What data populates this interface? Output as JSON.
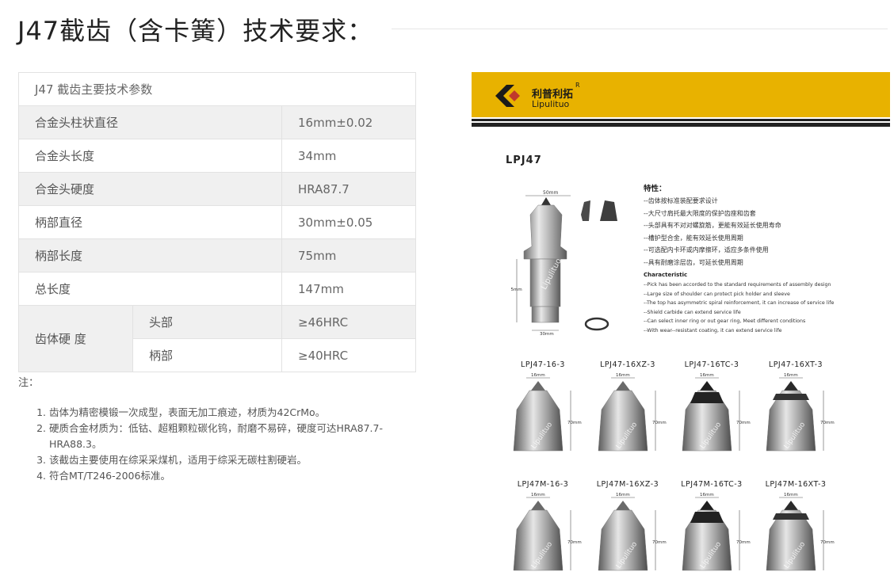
{
  "page": {
    "title": "J47截齿（含卡簧）技术要求："
  },
  "spec_table": {
    "header": "J47  截齿主要技术参数",
    "rows": [
      {
        "label": "合金头柱状直径",
        "value": "16mm±0.02"
      },
      {
        "label": "合金头长度",
        "value": "34mm"
      },
      {
        "label": "合金头硬度",
        "value": "HRA87.7"
      },
      {
        "label": "柄部直径",
        "value": "30mm±0.05"
      },
      {
        "label": "柄部长度",
        "value": "75mm"
      },
      {
        "label": "总长度",
        "value": "147mm"
      }
    ],
    "hardness": {
      "label": "齿体硬 度",
      "sub_rows": [
        {
          "label": "头部",
          "value": "≥46HRC"
        },
        {
          "label": "柄部",
          "value": "≥40HRC"
        }
      ]
    }
  },
  "notes": {
    "label": "注：",
    "items": [
      "齿体为精密模锻一次成型，表面无加工痕迹，材质为42CrMo。",
      "硬质合金材质为：低钴、超粗颗粒碳化钨，耐磨不易碎，硬度可达HRA87.7-HRA88.3。",
      "该截齿主要使用在综采采煤机，适用于综采无碳柱割硬岩。",
      "符合MT/T246-2006标准。"
    ]
  },
  "catalog": {
    "brand_cn": "利普利拓",
    "brand_reg": "R",
    "brand_en": "Lipulituo",
    "model": "LPJ47",
    "dim_top": "50mm",
    "dim_side": "75mm",
    "dim_bottom": "30mm",
    "watermark": "Lipulituo",
    "features_title": "特性：",
    "features_cn": [
      "--齿体按标准装配要求设计",
      "--大尺寸肩托最大限度的保护齿座和齿套",
      "--头部具有不对对螺旋筋，更能有效延长使用寿命",
      "--槽护型合金，能有效延长使用周期",
      "--可选配内卡环或内摩擦环，适应多条件使用",
      "--具有耐磨涂层齿，可延长使用周期"
    ],
    "characteristic_title": "Characteristic",
    "features_en": [
      "--Pick has been accorded to the standard requirements of assembly design",
      "--Large size of shoulder can protect pick holder and sleeve",
      "--The top has asymmetric spiral reinforcement, it can increase of service life",
      "--Shield carbide can extend service life",
      "--Can select inner ring or out gear ring, Meet different conditions",
      "--With wear--resistant coating, it can extend service life"
    ],
    "variants": [
      {
        "label": "LPJ47-16-3",
        "dim_top": "16mm",
        "dim_side": "70mm"
      },
      {
        "label": "LPJ47-16XZ-3",
        "dim_top": "16mm",
        "dim_side": "70mm"
      },
      {
        "label": "LPJ47-16TC-3",
        "dim_top": "16mm",
        "dim_side": "70mm"
      },
      {
        "label": "LPJ47-16XT-3",
        "dim_top": "16mm",
        "dim_side": "70mm"
      },
      {
        "label": "LPJ47M-16-3",
        "dim_top": "16mm",
        "dim_side": "70mm"
      },
      {
        "label": "LPJ47M-16XZ-3",
        "dim_top": "16mm",
        "dim_side": "70mm"
      },
      {
        "label": "LPJ47M-16TC-3",
        "dim_top": "16mm",
        "dim_side": "70mm"
      },
      {
        "label": "LPJ47M-16XT-3",
        "dim_top": "16mm",
        "dim_side": "70mm"
      }
    ],
    "colors": {
      "banner": "#e8b200",
      "logo_red": "#c0392b"
    }
  }
}
